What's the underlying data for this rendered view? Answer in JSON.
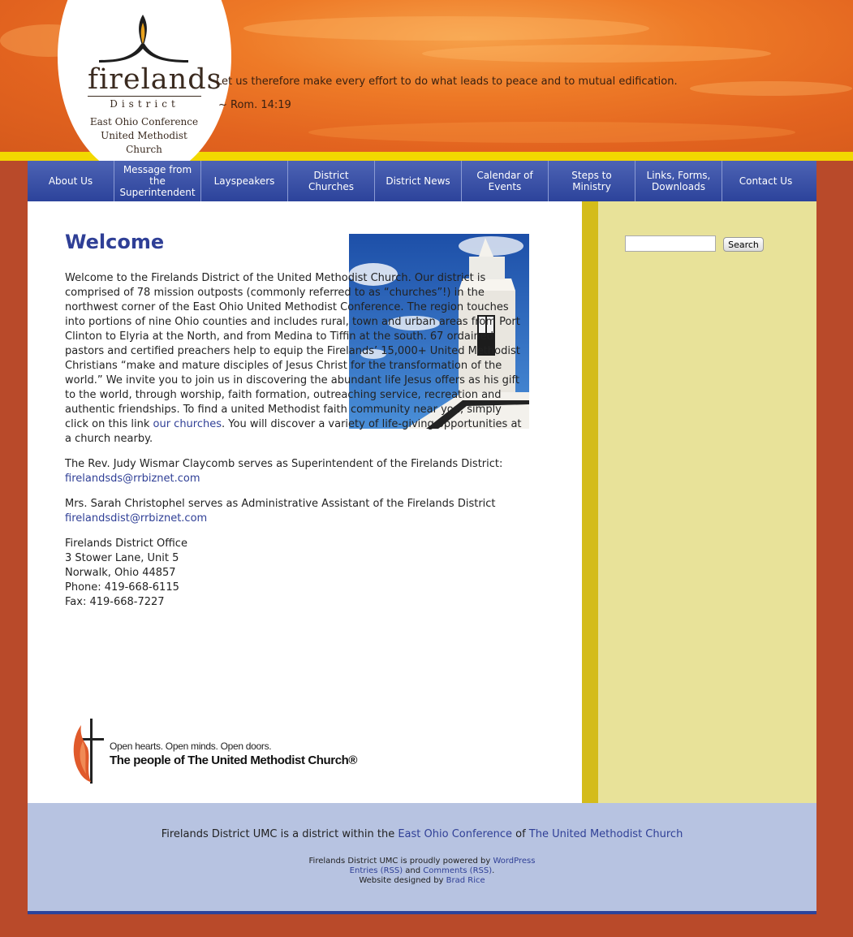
{
  "header": {
    "logo": {
      "name": "firelands",
      "district": "District",
      "conference_line1": "East Ohio Conference",
      "conference_line2": "United Methodist Church"
    },
    "verse": "Let us therefore make every effort to do what leads to peace and to mutual edification.",
    "verse_ref": "~ Rom. 14:19"
  },
  "nav": {
    "items": [
      {
        "label": "About Us"
      },
      {
        "label": "Message from the Superintendent"
      },
      {
        "label": "Layspeakers"
      },
      {
        "label": "District Churches"
      },
      {
        "label": "District News"
      },
      {
        "label": "Calendar of Events"
      },
      {
        "label": "Steps to Ministry"
      },
      {
        "label": "Links, Forms, Downloads"
      },
      {
        "label": "Contact Us"
      }
    ]
  },
  "main": {
    "title": "Welcome",
    "intro_before_link": "Welcome to the Firelands District of the United Methodist Church. Our district is comprised of 78 mission outposts (commonly referred to as “churches”!) in the northwest corner of the East Ohio United Methodist Conference. The region touches into portions of nine Ohio counties and includes rural, town and urban areas from Port Clinton to Elyria at the North, and from Medina to Tiffin at the south. 67 ordained pastors and certified preachers help to equip the Firelands’ 15,000+ United Methodist Christians “make and mature disciples of Jesus Christ for the transformation of the world.” We invite you to join us in discovering the abundant life Jesus offers as his gift to the world, through worship, faith formation, outreaching service, recreation and authentic friendships. To find a united Methodist faith community near you, simply click on this link",
    "churches_link": "our churches",
    "intro_after_link": ". You will discover a variety of life-giving opportunities at a church nearby.",
    "superintendent_text": "The Rev. Judy Wismar Claycomb serves as Superintendent of the Firelands District:",
    "superintendent_email": "firelandsds@rrbiznet.com",
    "assistant_text": "Mrs. Sarah Christophel serves as Administrative Assistant of the Firelands District",
    "assistant_email": "firelandsdist@rrbiznet.com",
    "office": {
      "name": "Firelands District Office",
      "street": "3 Stower Lane, Unit 5",
      "city": "Norwalk, Ohio 44857",
      "phone": "Phone: 419-668-6115",
      "fax": "Fax: 419-668-7227"
    },
    "umc_tagline": "Open hearts. Open minds. Open doors.",
    "umc_name": "The people of The United Methodist Church®"
  },
  "sidebar": {
    "search_button": "Search"
  },
  "footer": {
    "line1_a": "Firelands District UMC is a district within the ",
    "line1_link1": "East Ohio Conference",
    "line1_b": " of ",
    "line1_link2": "The United Methodist Church",
    "powered_text": "Firelands District UMC is proudly powered by ",
    "wordpress": "WordPress",
    "entries": "Entries (RSS)",
    "and": " and ",
    "comments": "Comments (RSS)",
    "period": ".",
    "designed_text": "Website designed by ",
    "designer": "Brad Rice"
  },
  "colors": {
    "nav": "#2c439b",
    "link": "#2f3f96",
    "sidebar": "#e8e299",
    "footer": "#b7c3e1",
    "page_bg": "#b94a2a"
  }
}
